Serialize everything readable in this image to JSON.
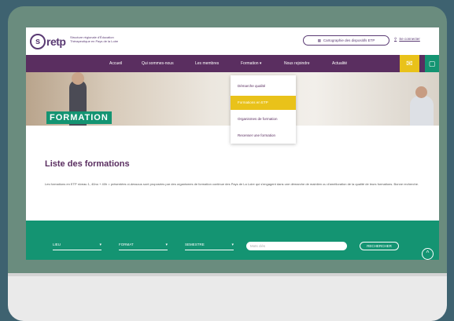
{
  "header": {
    "logo_mark": "s",
    "logo_text": "retp",
    "logo_subtitle": "Structure régionale d'Éducation Thérapeutique en Pays de la Loire",
    "carto_label": "Cartographie des dispositifs ETP",
    "connect_label": "Se connecter"
  },
  "nav": {
    "items": [
      "Accueil",
      "Qui sommes-nous",
      "Les membres",
      "Formation",
      "Nous rejoindre",
      "Actualité"
    ]
  },
  "dropdown": {
    "items": [
      "Démarche qualité",
      "Formations en ETP",
      "Organismes de formation",
      "Recenser une formation"
    ]
  },
  "hero": {
    "title": "FORMATION"
  },
  "main": {
    "title": "Liste des formations",
    "intro": "Les formations en ETP niveau 1, 40no + 40h = présentées ci-dessous sont proposées par des organismes de formation continue des Pays de La Loire qui s'engagent dans une démarche de maintien ou d'amélioration de la qualité de leurs formations. Bonne recherche."
  },
  "filters": {
    "lieu": "LIEU",
    "format": "FORMAT",
    "semestre": "SEMESTRE",
    "search_placeholder": "Mots clés",
    "search_button": "RECHERCHER"
  }
}
